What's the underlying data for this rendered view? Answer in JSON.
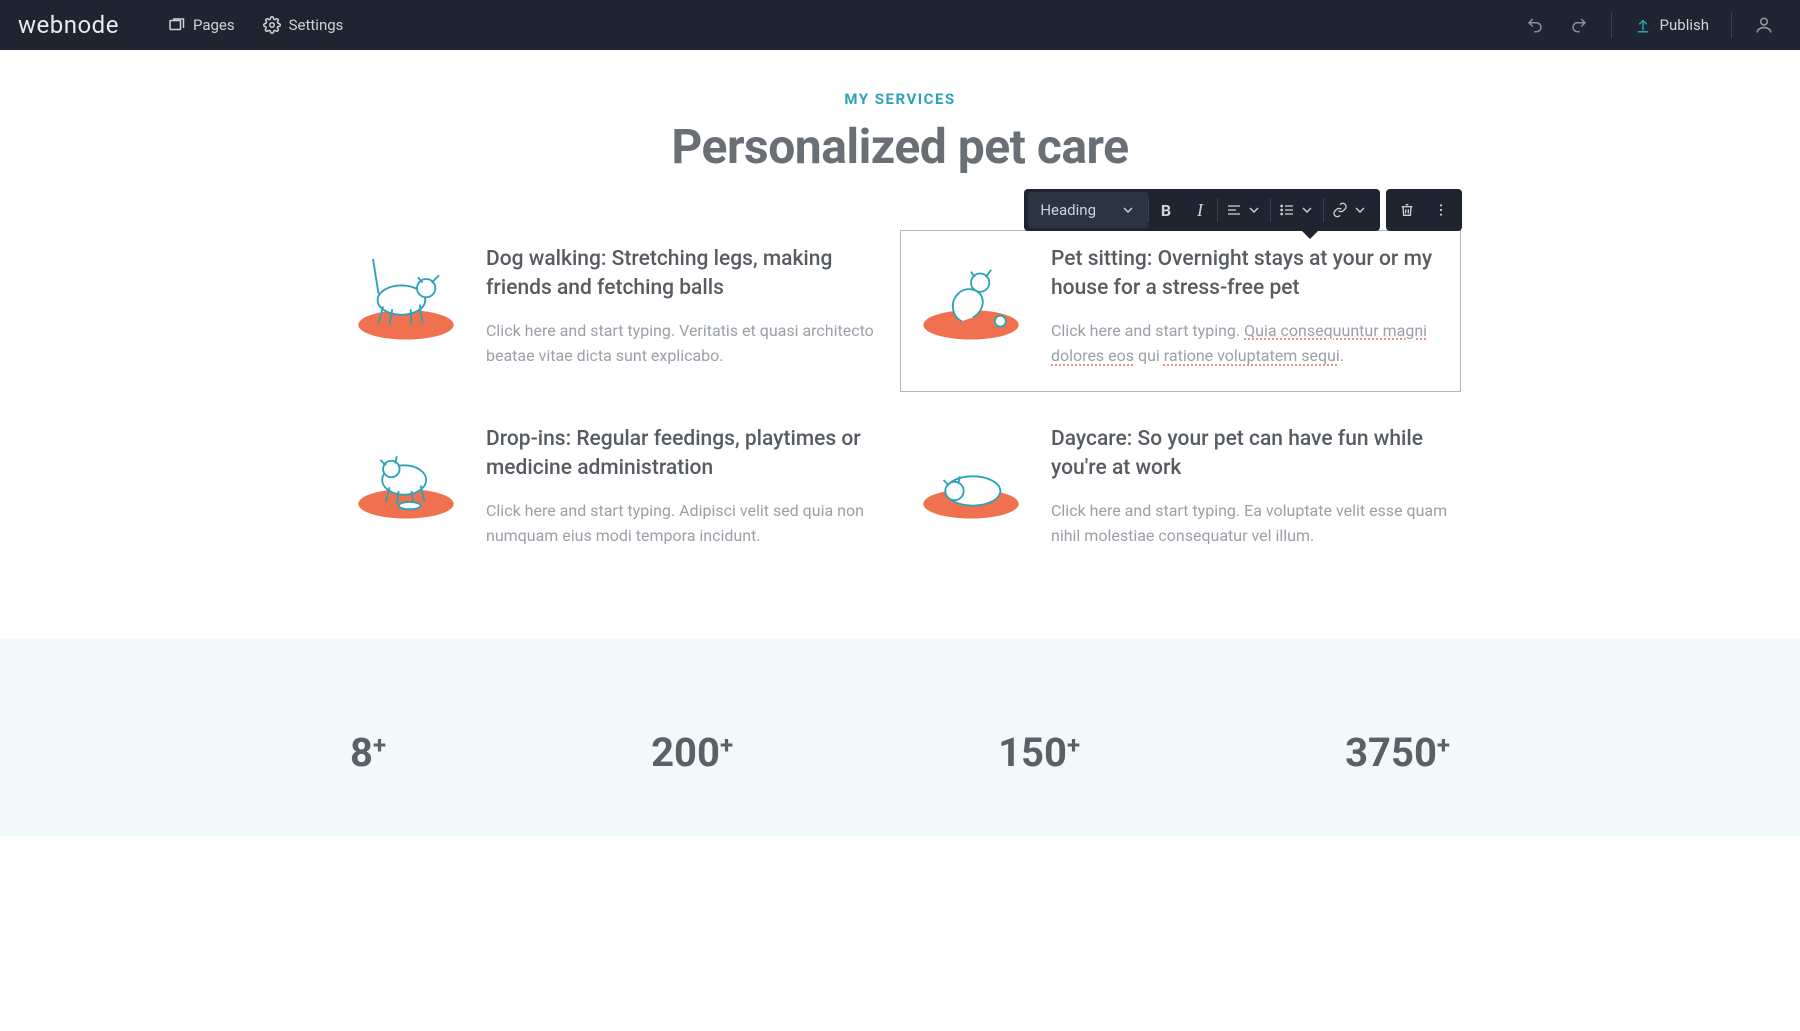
{
  "topbar": {
    "brand": "webnode",
    "pages": "Pages",
    "settings": "Settings",
    "publish": "Publish"
  },
  "page": {
    "eyebrow": "MY SERVICES",
    "title": "Personalized pet care"
  },
  "toolbar": {
    "text_style": "Heading"
  },
  "services": [
    {
      "title": "Dog walking: Stretching legs, making friends and fetching balls",
      "body": "Click here and start typing. Veritatis et quasi architecto beatae vitae dicta sunt explicabo."
    },
    {
      "title": "Pet sitting: Overnight stays at your or my house for a stress-free pet",
      "body_prefix": "Click here and start typing. ",
      "body_spell1": "Quia consequuntur magni dolores eos",
      "body_mid": " qui ",
      "body_spell2": "ratione voluptatem sequi",
      "body_suffix": "."
    },
    {
      "title": "Drop-ins: Regular feedings, playtimes or medicine administration",
      "body": "Click here and start typing. Adipisci velit sed quia non numquam eius modi tempora incidunt."
    },
    {
      "title": "Daycare: So your pet can have fun while you're at work",
      "body": "Click here and start typing. Ea voluptate velit esse quam nihil molestiae consequatur vel illum."
    }
  ],
  "stats": [
    {
      "n": "8",
      "suffix": "+"
    },
    {
      "n": "200",
      "suffix": "+"
    },
    {
      "n": "150",
      "suffix": "+"
    },
    {
      "n": "3750",
      "suffix": "+"
    }
  ]
}
